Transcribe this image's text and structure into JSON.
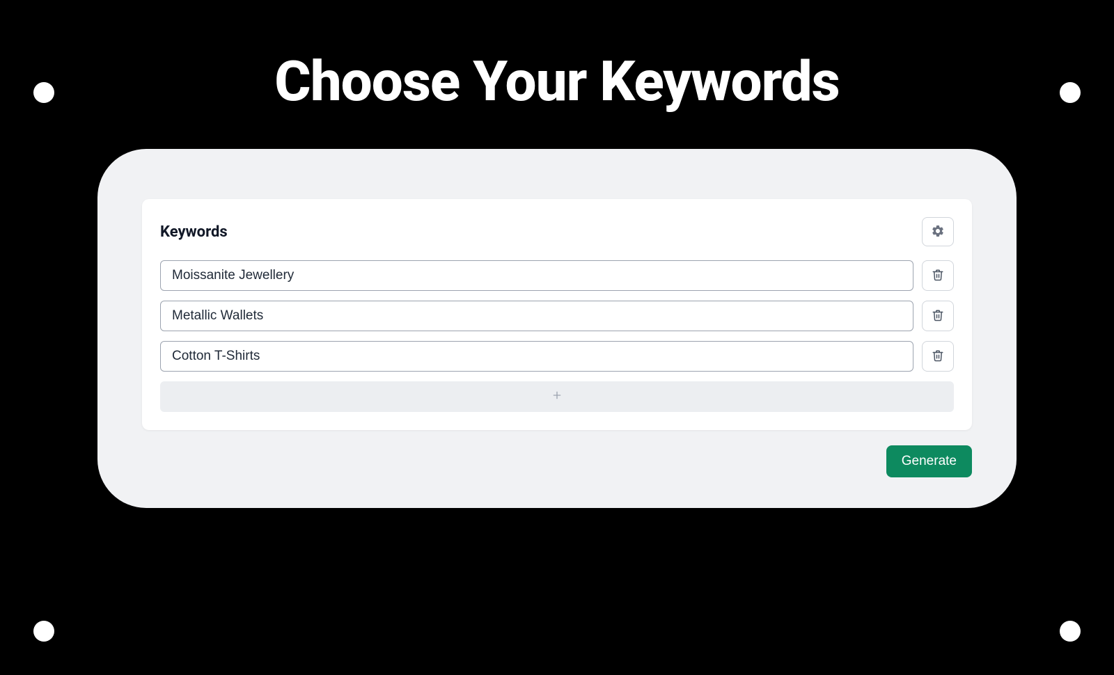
{
  "page": {
    "title": "Choose Your Keywords"
  },
  "card": {
    "title": "Keywords",
    "keywords": [
      {
        "value": "Moissanite Jewellery"
      },
      {
        "value": "Metallic Wallets"
      },
      {
        "value": "Cotton T-Shirts"
      }
    ]
  },
  "actions": {
    "generate_label": "Generate"
  },
  "colors": {
    "accent": "#0d8a5f",
    "panel_bg": "#f1f2f4",
    "page_bg": "#000000"
  }
}
